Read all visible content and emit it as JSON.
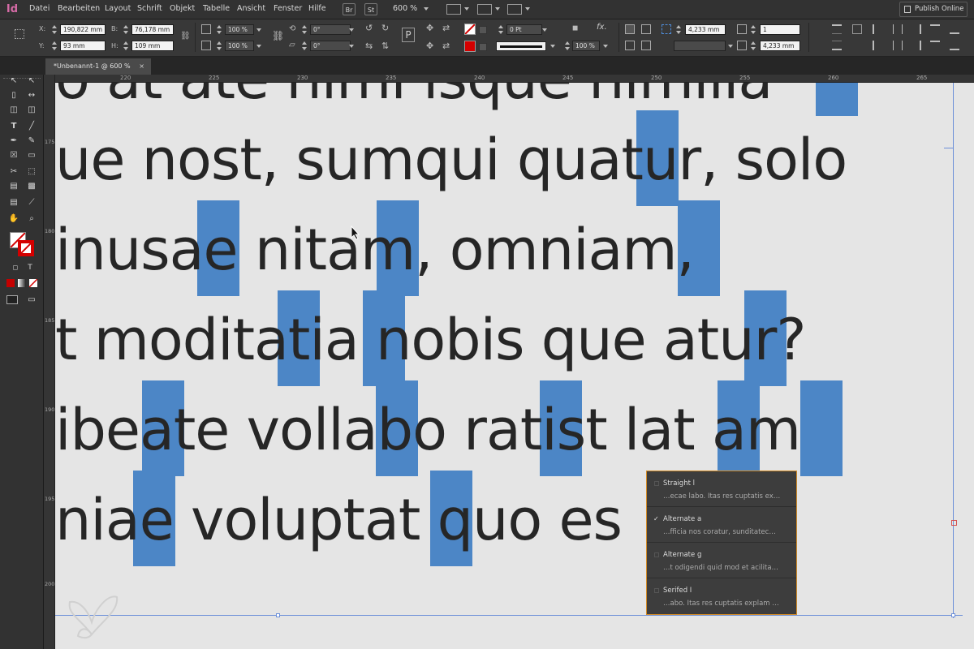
{
  "app": {
    "logo": "Id"
  },
  "menu": {
    "items": [
      "Datei",
      "Bearbeiten",
      "Layout",
      "Schrift",
      "Objekt",
      "Tabelle",
      "Ansicht",
      "Fenster",
      "Hilfe"
    ],
    "bridge": "Br",
    "stock": "St",
    "zoom": "600 %",
    "publish": "Publish Online"
  },
  "control": {
    "x_label": "X:",
    "y_label": "Y:",
    "x_value": "190,822 mm",
    "y_value": "93 mm",
    "w_label": "B:",
    "h_label": "H:",
    "w_value": "76,178 mm",
    "h_value": "109 mm",
    "scale_x": "100 %",
    "scale_y": "100 %",
    "rotate": "0°",
    "shear": "0°",
    "stroke_weight": "0 Pt",
    "opacity": "100 %",
    "offset_1": "4,233 mm",
    "offset_2": "4,233 mm",
    "columns": "1",
    "gutter": "4,233 mm"
  },
  "tab": {
    "title": "*Unbenannt-1 @ 600 %",
    "close": "×"
  },
  "ruler": {
    "h_ticks": [
      "220",
      "225",
      "230",
      "235",
      "240",
      "245",
      "250",
      "255",
      "260",
      "265"
    ],
    "v_ticks": [
      "175",
      "180",
      "185",
      "190",
      "195",
      "200"
    ]
  },
  "text_lines": [
    "o at ate nimi isque nimilla",
    "ue nost, sumqui quatur, solo",
    " inusae nitam, omniam,",
    "t moditatia nobis que atur?",
    "ibeate vollabo ratist lat am",
    " niae voluptat quo      es"
  ],
  "popup": {
    "items": [
      {
        "name": "Straight l",
        "sample": "…ecae labo. Itas res cuptatis ex…",
        "checked": false
      },
      {
        "name": "Alternate a",
        "sample": "…fficia nos coratur, sunditatec…",
        "checked": true
      },
      {
        "name": "Alternate g",
        "sample": "…t odigendi quid mod et acilita…",
        "checked": false
      },
      {
        "name": "Serifed I",
        "sample": "…abo. Itas res cuptatis explam …",
        "checked": false
      }
    ],
    "check_mark": "✓"
  },
  "colors": {
    "highlight": "#4c86c6",
    "popup_border": "#d28b27",
    "guide": "#6c8fd8",
    "logo": "#d66ba6"
  }
}
